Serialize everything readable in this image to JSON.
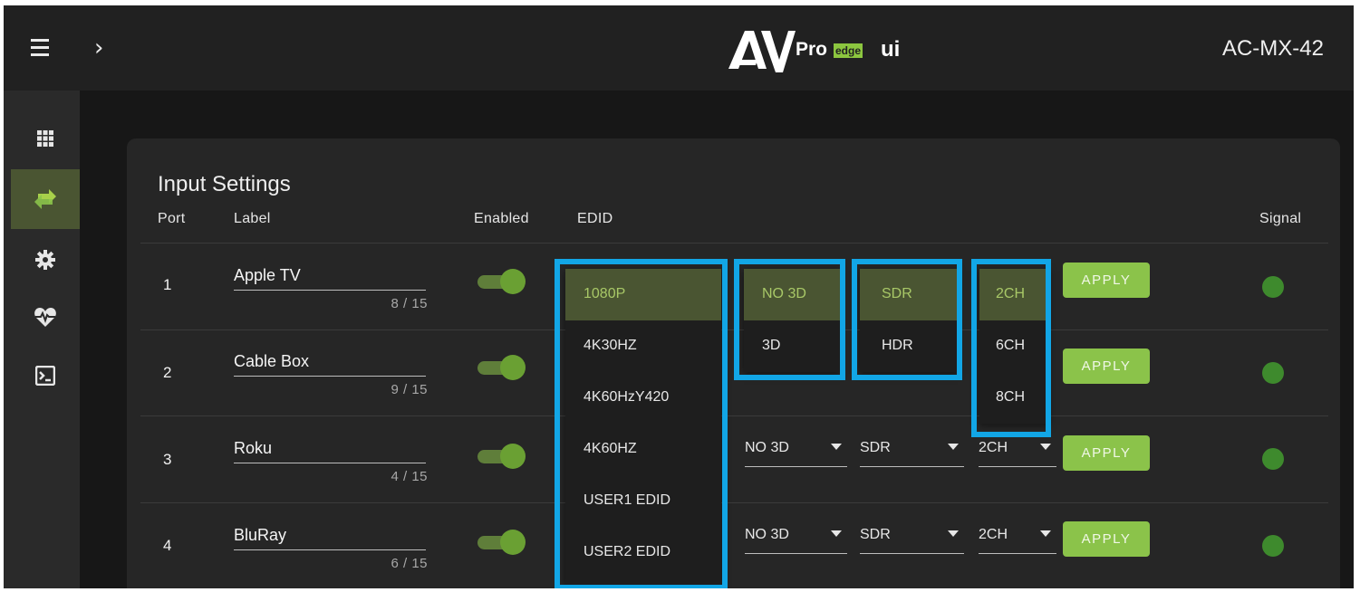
{
  "header": {
    "logo": {
      "av": "AV",
      "pro": "Pro",
      "edge": "edge",
      "ui": "ui"
    },
    "device": "AC-MX-42"
  },
  "sidebar": {
    "items": [
      {
        "icon": "grid-icon",
        "active": false
      },
      {
        "icon": "swap-arrows-icon",
        "active": true
      },
      {
        "icon": "gear-icon",
        "active": false
      },
      {
        "icon": "heart-pulse-icon",
        "active": false
      },
      {
        "icon": "terminal-icon",
        "active": false
      }
    ]
  },
  "card": {
    "title": "Input Settings",
    "columns": {
      "port": "Port",
      "label": "Label",
      "enabled": "Enabled",
      "edid": "EDID",
      "signal": "Signal"
    },
    "rows": [
      {
        "port": "1",
        "label": "Apple TV",
        "counter": "8 / 15",
        "enabled": true,
        "edid": "1080P",
        "d3": "NO 3D",
        "hdr": "SDR",
        "ch": "2CH",
        "apply": "APPLY",
        "signal": "on"
      },
      {
        "port": "2",
        "label": "Cable Box",
        "counter": "9 / 15",
        "enabled": true,
        "edid": "",
        "d3": "",
        "hdr": "",
        "ch": "",
        "apply": "APPLY",
        "signal": "on"
      },
      {
        "port": "3",
        "label": "Roku",
        "counter": "4 / 15",
        "enabled": true,
        "edid": "",
        "d3": "NO 3D",
        "hdr": "SDR",
        "ch": "2CH",
        "apply": "APPLY",
        "signal": "on"
      },
      {
        "port": "4",
        "label": "BluRay",
        "counter": "6 / 15",
        "enabled": true,
        "edid": "",
        "d3": "NO 3D",
        "hdr": "SDR",
        "ch": "2CH",
        "apply": "APPLY",
        "signal": "on"
      }
    ]
  },
  "menus": {
    "edid": {
      "options": [
        "1080P",
        "4K30HZ",
        "4K60HzY420",
        "4K60HZ",
        "USER1 EDID",
        "USER2 EDID"
      ],
      "selected": "1080P"
    },
    "d3": {
      "options": [
        "NO 3D",
        "3D"
      ],
      "selected": "NO 3D"
    },
    "hdr": {
      "options": [
        "SDR",
        "HDR"
      ],
      "selected": "SDR"
    },
    "ch": {
      "options": [
        "2CH",
        "6CH",
        "8CH"
      ],
      "selected": "2CH"
    }
  },
  "colors": {
    "accent": "#8bc34a",
    "highlight_box": "#12a6e6",
    "signal": "#3e8a2d",
    "selected_bg": "#4a5532"
  }
}
